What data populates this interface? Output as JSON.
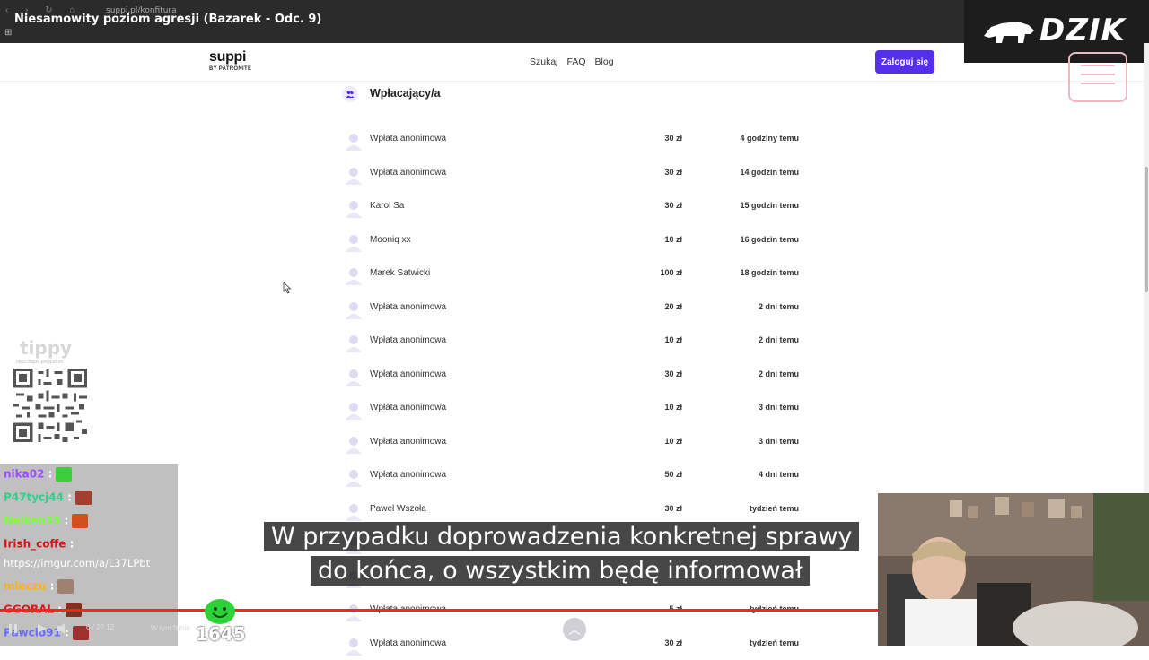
{
  "browser": {
    "url": "suppi.pl/konfitura",
    "video_title": "Niesamowity poziom agresji (Bazarek - Odc. 9)"
  },
  "header": {
    "logo_main": "suppi",
    "logo_sub": "BY PATRONITE",
    "nav": [
      "Szukaj",
      "FAQ",
      "Blog"
    ],
    "login_label": "Zaloguj się",
    "accent_color": "#5530ea"
  },
  "overlay": {
    "brand": "DZIK",
    "tippy_logo": "tippy",
    "tippy_url": "https://tipply.pl/@patron"
  },
  "section": {
    "title": "Wpłacający/a"
  },
  "donations": [
    {
      "name": "Wpłata anonimowa",
      "amount": "30 zł",
      "when": "4 godziny temu"
    },
    {
      "name": "Wpłata anonimowa",
      "amount": "30 zł",
      "when": "14 godzin temu"
    },
    {
      "name": "Karol Sa",
      "amount": "30 zł",
      "when": "15 godzin temu"
    },
    {
      "name": "Mooniq xx",
      "amount": "10 zł",
      "when": "16 godzin temu"
    },
    {
      "name": "Marek Satwicki",
      "amount": "100 zł",
      "when": "18 godzin temu"
    },
    {
      "name": "Wpłata anonimowa",
      "amount": "20 zł",
      "when": "2 dni temu"
    },
    {
      "name": "Wpłata anonimowa",
      "amount": "10 zł",
      "when": "2 dni temu"
    },
    {
      "name": "Wpłata anonimowa",
      "amount": "30 zł",
      "when": "2 dni temu"
    },
    {
      "name": "Wpłata anonimowa",
      "amount": "10 zł",
      "when": "3 dni temu"
    },
    {
      "name": "Wpłata anonimowa",
      "amount": "10 zł",
      "when": "3 dni temu"
    },
    {
      "name": "Wpłata anonimowa",
      "amount": "50 zł",
      "when": "4 dni temu"
    },
    {
      "name": "Paweł Wszoła",
      "amount": "30 zł",
      "when": "tydzień temu"
    },
    {
      "name": "",
      "amount": "",
      "when": ""
    },
    {
      "name": "",
      "amount": "",
      "when": ""
    },
    {
      "name": "Wpłata anonimowa",
      "amount": "5 zł",
      "when": "tydzień temu"
    },
    {
      "name": "Wpłata anonimowa",
      "amount": "30 zł",
      "when": "tydzień temu"
    }
  ],
  "chat": [
    {
      "user": "nika02",
      "sep": " :",
      "color": "#9b4dff"
    },
    {
      "user": "P47tycj44",
      "sep": " :",
      "color": "#2fd08a"
    },
    {
      "user": "Naiken35",
      "sep": " :",
      "color": "#7cff3a"
    },
    {
      "user": "Irish_coffe",
      "sep": " :",
      "color": "#d4141a"
    },
    {
      "user": "https://imgur.com/a/L37LPbt",
      "sep": "",
      "color": "#ffffff"
    },
    {
      "user": "mieczu",
      "sep": " :",
      "color": "#ffb020"
    },
    {
      "user": "GGORAL",
      "sep": " :",
      "color": "#e01818"
    },
    {
      "user": "Pawcio91",
      "sep": " :",
      "color": "#6a6aff"
    }
  ],
  "subtitles": {
    "line1": "W przypadku doprowadzenia konkretnej sprawy",
    "line2": "do końca, o wszystkim będę informował"
  },
  "player": {
    "time": "6 / 27:12",
    "in_video": "W tym filmie",
    "counter": "1645"
  }
}
